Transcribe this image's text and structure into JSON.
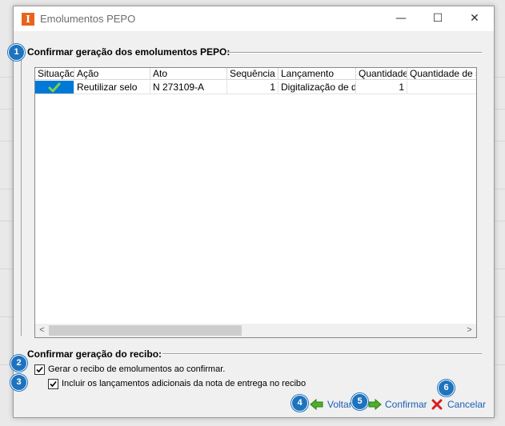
{
  "window": {
    "title": "Emolumentos PEPO",
    "minimize_glyph": "—",
    "maximize_glyph": "☐",
    "close_glyph": "✕",
    "app_icon_letter": "I"
  },
  "section1": {
    "heading": "Confirmar geração dos emolumentos PEPO:",
    "badge": "1"
  },
  "grid": {
    "columns": [
      "Situação",
      "Ação",
      "Ato",
      "Sequência",
      "Lançamento",
      "Quantidade",
      "Quantidade de se"
    ],
    "rows": [
      {
        "situacao_icon": "checkmark-icon",
        "acao": "Reutilizar selo",
        "ato": "N 273109-A",
        "sequencia": "1",
        "lancamento": "Digitalização de doc",
        "quantidade": "1",
        "quantidade_se": ""
      }
    ],
    "scroll_left_glyph": "<",
    "scroll_right_glyph": ">"
  },
  "section2": {
    "heading": "Confirmar geração do recibo:",
    "badge2": "2",
    "badge3": "3",
    "check1_label": "Gerar o recibo de emolumentos ao confirmar.",
    "check1_checked": true,
    "check2_label": "Incluir os lançamentos adicionais da nota de entrega no recibo",
    "check2_checked": true
  },
  "footer": {
    "voltar_label": "Voltar",
    "voltar_badge": "4",
    "confirmar_label": "Confirmar",
    "confirmar_badge": "5",
    "cancelar_label": "Cancelar",
    "cancelar_badge": "6"
  },
  "colors": {
    "badge": "#1e73be",
    "link_text": "#1a5fb4",
    "selection": "#0078d7",
    "arrow_green": "#4caf28",
    "cancel_red": "#d62020"
  }
}
